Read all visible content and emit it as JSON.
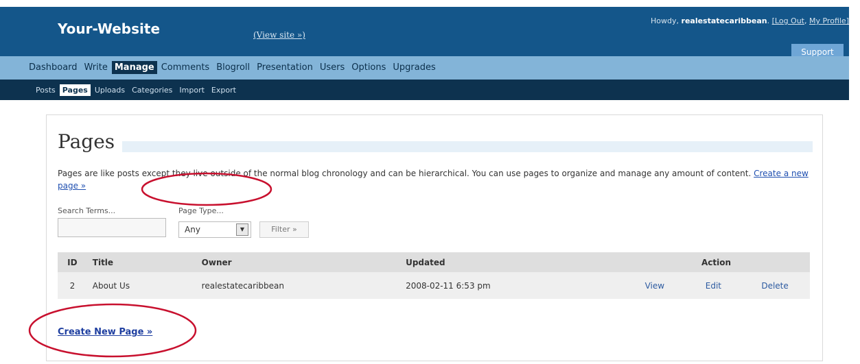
{
  "header": {
    "site_title": "Your-Website",
    "view_site": "(View site »)",
    "howdy_prefix": "Howdy,",
    "username": "realestatecaribbean",
    "log_out": "[Log Out",
    "my_profile": "My Profile]",
    "support": "Support"
  },
  "main_nav": [
    {
      "label": "Dashboard"
    },
    {
      "label": "Write"
    },
    {
      "label": "Manage",
      "active": true
    },
    {
      "label": "Comments"
    },
    {
      "label": "Blogroll"
    },
    {
      "label": "Presentation"
    },
    {
      "label": "Users"
    },
    {
      "label": "Options"
    },
    {
      "label": "Upgrades"
    }
  ],
  "sub_nav": [
    {
      "label": "Posts"
    },
    {
      "label": "Pages",
      "active": true
    },
    {
      "label": "Uploads"
    },
    {
      "label": "Categories"
    },
    {
      "label": "Import"
    },
    {
      "label": "Export"
    }
  ],
  "page": {
    "heading": "Pages",
    "description": "Pages are like posts except they live outside of the normal blog chronology and can be hierarchical. You can use pages to organize and manage any amount of content.",
    "create_link": "Create a new page »",
    "search_label": "Search Terms...",
    "search_value": "",
    "page_type_label": "Page Type...",
    "page_type_value": "Any",
    "filter_button": "Filter »",
    "create_new_page": "Create New Page »"
  },
  "table": {
    "headers": {
      "id": "ID",
      "title": "Title",
      "owner": "Owner",
      "updated": "Updated",
      "action": "Action"
    },
    "rows": [
      {
        "id": "2",
        "title": "About Us",
        "owner": "realestatecaribbean",
        "updated": "2008-02-11 6:53 pm",
        "view": "View",
        "edit": "Edit",
        "delete": "Delete"
      }
    ]
  },
  "colors": {
    "header_bg": "#14568a",
    "main_nav_bg": "#83b4d8",
    "sub_nav_bg": "#0d324f",
    "annotation_circle": "#c8102e"
  }
}
